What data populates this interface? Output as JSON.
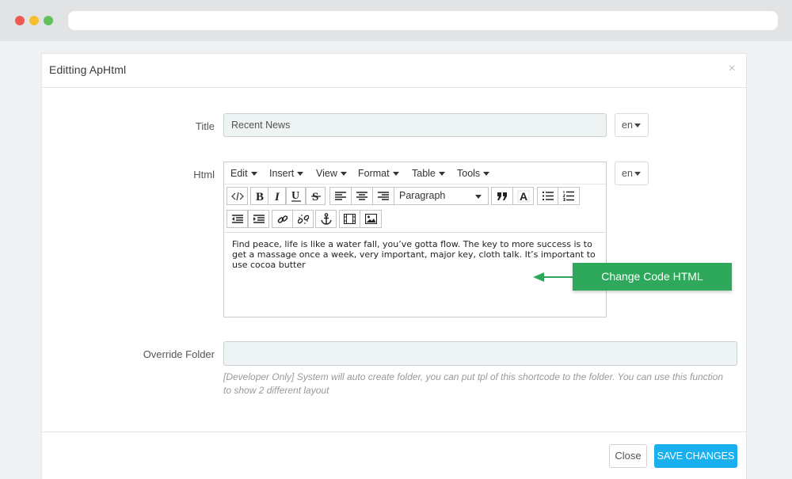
{
  "modal": {
    "title": "Editting ApHtml",
    "close_icon": "×"
  },
  "form": {
    "title_label": "Title",
    "title_value": "Recent News",
    "title_lang": "en",
    "html_label": "Html",
    "html_lang": "en",
    "override_label": "Override Folder",
    "override_value": "",
    "override_help": "[Developer Only] System will auto create folder, you can put tpl of this shortcode to the folder. You can use this function to show 2 different layout"
  },
  "editor": {
    "menu": [
      "Edit",
      "Insert",
      "View",
      "Format",
      "Table",
      "Tools"
    ],
    "toolbar_icons": [
      "code-icon",
      "bold-icon",
      "italic-icon",
      "underline-icon",
      "strikethrough-icon",
      "align-left-icon",
      "align-center-icon",
      "align-right-icon",
      "blockquote-icon",
      "text-color-icon",
      "bullet-list-icon",
      "numbered-list-icon",
      "outdent-icon",
      "indent-icon",
      "link-icon",
      "unlink-icon",
      "anchor-icon",
      "media-icon",
      "image-icon"
    ],
    "format_select": "Paragraph",
    "content": "Find peace, life is like a water fall, you’ve gotta flow. The key to more success is to get a massage once a week, very important, major key, cloth talk. It’s important to use cocoa butter"
  },
  "callout": {
    "text": "Change Code HTML",
    "color": "#2ea85a"
  },
  "footer": {
    "close_label": "Close",
    "save_label": "SAVE CHANGES",
    "save_color": "#19b0f0"
  }
}
